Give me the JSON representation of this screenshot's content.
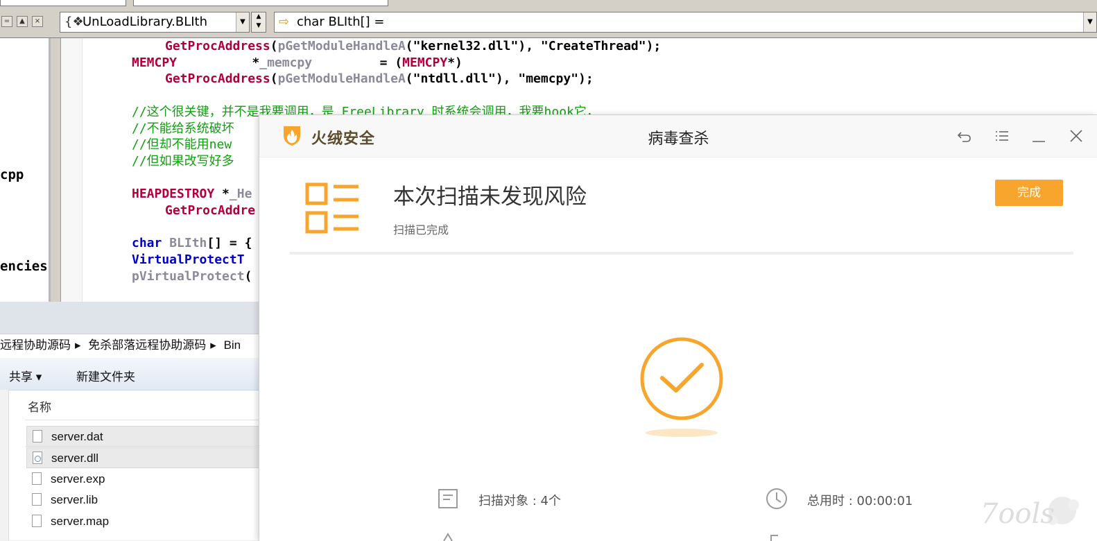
{
  "ide": {
    "function_combo": {
      "icon": "class-member-icon",
      "value": "UnLoadLibrary.BLIth"
    },
    "scope_combo": {
      "icon": "arrow-right-icon",
      "value": "char BLIth[] ="
    },
    "left_panel_fragments": [
      "cpp",
      "encies"
    ],
    "code_lines": [
      {
        "indent": 10,
        "parts": [
          {
            "t": "GetProcAddress",
            "c": "c-red"
          },
          {
            "t": "(",
            "c": "c-black"
          },
          {
            "t": "pGetModuleHandleA",
            "c": "c-gray"
          },
          {
            "t": "(\"kernel32.dll\"), \"CreateThread\");",
            "c": "c-black"
          }
        ]
      },
      {
        "indent": 6,
        "parts": [
          {
            "t": "MEMCPY",
            "c": "c-red"
          },
          {
            "t": "          *",
            "c": "c-black"
          },
          {
            "t": "_memcpy",
            "c": "c-gray"
          },
          {
            "t": "         = (",
            "c": "c-black"
          },
          {
            "t": "MEMCPY",
            "c": "c-red"
          },
          {
            "t": "*)",
            "c": "c-black"
          }
        ]
      },
      {
        "indent": 10,
        "parts": [
          {
            "t": "GetProcAddress",
            "c": "c-red"
          },
          {
            "t": "(",
            "c": "c-black"
          },
          {
            "t": "pGetModuleHandleA",
            "c": "c-gray"
          },
          {
            "t": "(\"ntdll.dll\"), \"memcpy\");",
            "c": "c-black"
          }
        ]
      },
      {
        "indent": 0,
        "parts": []
      },
      {
        "indent": 6,
        "parts": [
          {
            "t": "//这个很关键，并不是我要调用，是 FreeLibrary 时系统会调用，我要hook它，",
            "c": "c-green"
          }
        ]
      },
      {
        "indent": 6,
        "parts": [
          {
            "t": "//不能给系统破坏",
            "c": "c-green"
          }
        ]
      },
      {
        "indent": 6,
        "parts": [
          {
            "t": "//但却不能用new",
            "c": "c-green"
          }
        ]
      },
      {
        "indent": 6,
        "parts": [
          {
            "t": "//但如果改写好多",
            "c": "c-green"
          }
        ]
      },
      {
        "indent": 0,
        "parts": []
      },
      {
        "indent": 6,
        "parts": [
          {
            "t": "HEAPDESTROY",
            "c": "c-red"
          },
          {
            "t": " *",
            "c": "c-black"
          },
          {
            "t": "_He",
            "c": "c-gray"
          }
        ]
      },
      {
        "indent": 10,
        "parts": [
          {
            "t": "GetProcAddre",
            "c": "c-red"
          }
        ]
      },
      {
        "indent": 0,
        "parts": []
      },
      {
        "indent": 6,
        "parts": [
          {
            "t": "char",
            "c": "c-blue"
          },
          {
            "t": " BLIth",
            "c": "c-gray"
          },
          {
            "t": "[] = {",
            "c": "c-black"
          }
        ]
      },
      {
        "indent": 6,
        "parts": [
          {
            "t": "VirtualProtectT",
            "c": "c-blue"
          }
        ]
      },
      {
        "indent": 6,
        "parts": [
          {
            "t": "pVirtualProtect",
            "c": "c-gray"
          },
          {
            "t": "(",
            "c": "c-black"
          }
        ]
      }
    ]
  },
  "explorer": {
    "breadcrumb": [
      "远程协助源码",
      "免杀部落远程协助源码",
      "Bin"
    ],
    "toolbar": {
      "share_label": "共享 ▾",
      "new_folder_label": "新建文件夹"
    },
    "column_header": "名称",
    "files": [
      {
        "name": "server.dat",
        "icon": "file-icon",
        "selected": true
      },
      {
        "name": "server.dll",
        "icon": "dll-file-icon",
        "selected": true
      },
      {
        "name": "server.exp",
        "icon": "file-icon",
        "selected": false
      },
      {
        "name": "server.lib",
        "icon": "file-icon",
        "selected": false
      },
      {
        "name": "server.map",
        "icon": "file-icon",
        "selected": false
      }
    ]
  },
  "dialog": {
    "brand": "火绒安全",
    "title": "病毒查杀",
    "summary_title": "本次扫描未发现风险",
    "summary_subtitle": "扫描已完成",
    "done_button": "完成",
    "stats": {
      "objects_label": "扫描对象 : 4个",
      "time_label": "总用时 : 00:00:01"
    },
    "accent_color": "#f7a52d"
  },
  "watermark": "7ools"
}
